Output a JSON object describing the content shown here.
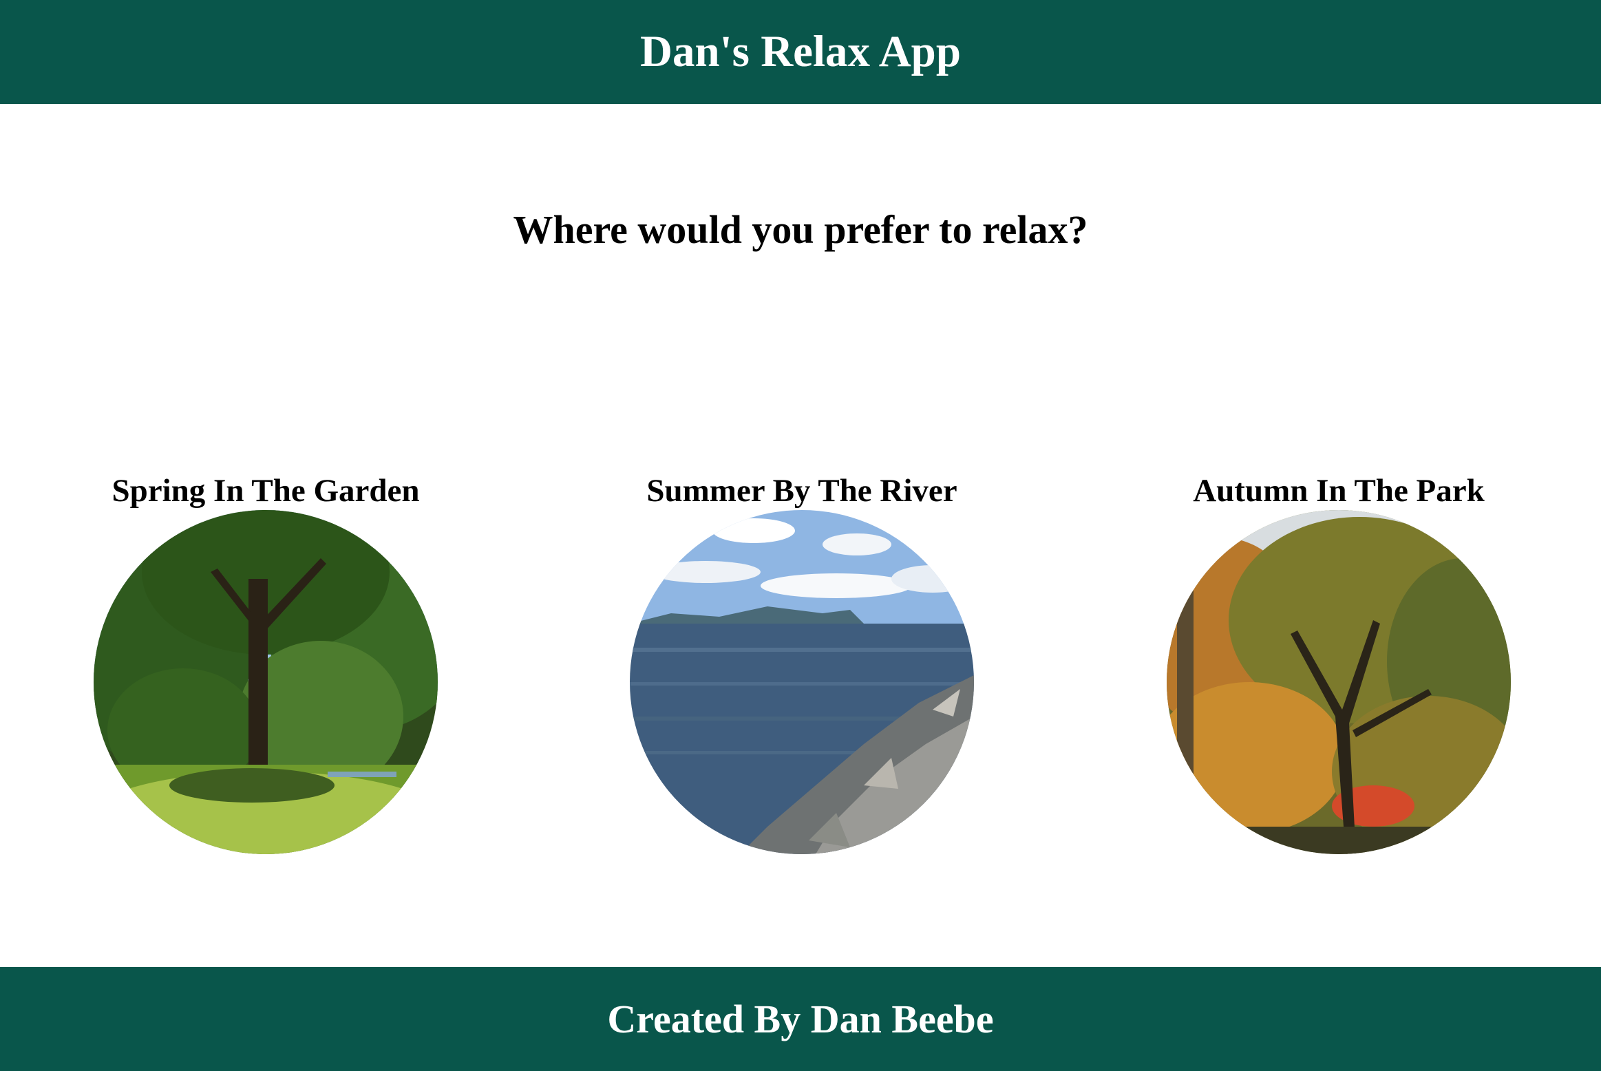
{
  "app": {
    "title": "Dan's Relax App"
  },
  "main": {
    "question": "Where would you prefer to relax?",
    "options": [
      {
        "label": "Spring In The Garden",
        "image": "spring-garden-trees"
      },
      {
        "label": "Summer By The River",
        "image": "summer-river-rocks"
      },
      {
        "label": "Autumn In The Park",
        "image": "autumn-park-trees"
      }
    ]
  },
  "footer": {
    "credit": "Created By Dan Beebe"
  },
  "colors": {
    "brand": "#09564b",
    "text": "#000000",
    "header_text": "#ffffff"
  }
}
